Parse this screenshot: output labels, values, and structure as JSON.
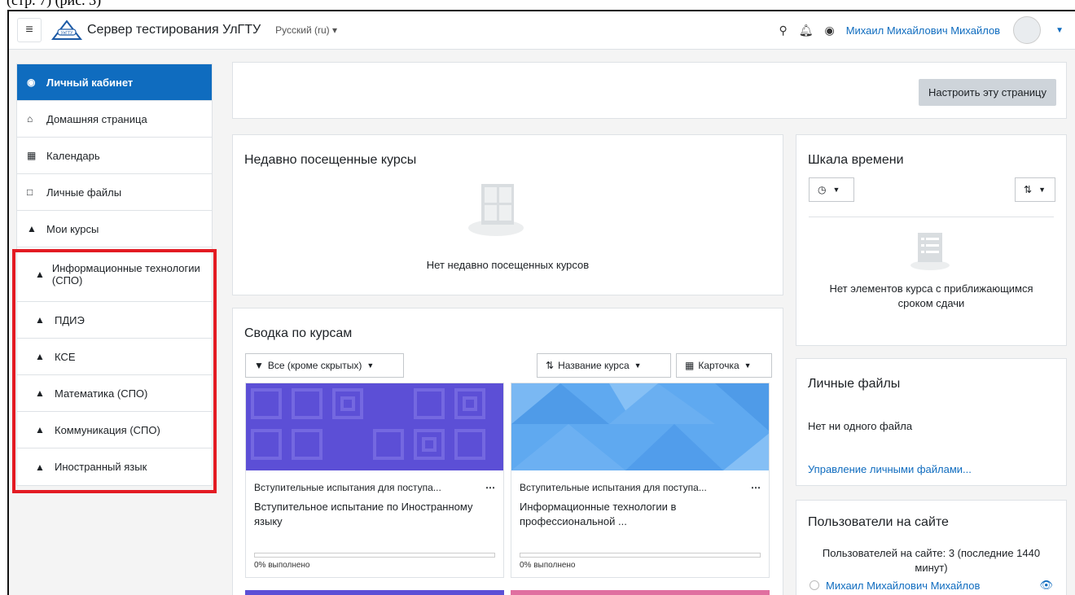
{
  "caption_fragment": "(стр. 7) (рис. 3)",
  "navbar": {
    "site_name": "Сервер тестирования УлГТУ",
    "language": "Русский (ru) ▾",
    "user_name": "Михаил Михайлович Михайлов"
  },
  "sidebar": {
    "items": [
      {
        "label": "Личный кабинет",
        "icon": "dashboard-icon"
      },
      {
        "label": "Домашняя страница",
        "icon": "home-icon"
      },
      {
        "label": "Календарь",
        "icon": "calendar-icon"
      },
      {
        "label": "Личные файлы",
        "icon": "file-icon"
      },
      {
        "label": "Мои курсы",
        "icon": "graduation-cap-icon"
      }
    ],
    "courses": [
      {
        "label": "Информационные технологии (СПО)"
      },
      {
        "label": "ПДИЭ"
      },
      {
        "label": "КСЕ"
      },
      {
        "label": "Математика (СПО)"
      },
      {
        "label": "Коммуникация (СПО)"
      },
      {
        "label": "Иностранный язык"
      }
    ]
  },
  "header_card": {
    "customize_button": "Настроить эту страницу"
  },
  "recent": {
    "title": "Недавно посещенные курсы",
    "empty": "Нет недавно посещенных курсов"
  },
  "overview": {
    "title": "Сводка по курсам",
    "filter": "Все (кроме скрытых)",
    "sort": "Название курса",
    "view": "Карточка",
    "courses": [
      {
        "category": "Вступительные испытания для поступа...",
        "name": "Вступительное испытание по Иностранному языку",
        "progress_label": "0% выполнено",
        "progress": 0,
        "color": "#5c4fd6"
      },
      {
        "category": "Вступительные испытания для поступа...",
        "name": "Информационные технологии в профессиональной ...",
        "progress_label": "0% выполнено",
        "progress": 0,
        "color": "#5fa9f0"
      }
    ]
  },
  "timeline": {
    "title": "Шкала времени",
    "empty": "Нет элементов курса с приближающимся сроком сдачи"
  },
  "private_files": {
    "title": "Личные файлы",
    "empty": "Нет ни одного файла",
    "manage": "Управление личными файлами..."
  },
  "online_users": {
    "title": "Пользователи на сайте",
    "count_text": "Пользователей на сайте: 3 (последние 1440 минут)",
    "user": "Михаил Михайлович Михайлов"
  },
  "colors": {
    "accent": "#0f6cbf",
    "highlight": "#e31b23"
  }
}
